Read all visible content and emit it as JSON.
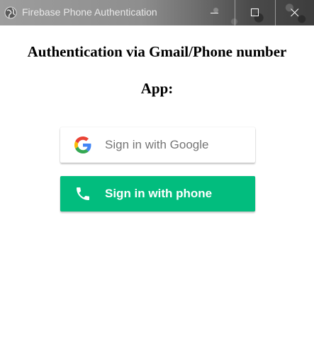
{
  "window": {
    "title": "Firebase Phone Authentication",
    "minimize_icon": "minimize-icon",
    "maximize_icon": "maximize-icon",
    "close_icon": "close-icon",
    "app_icon": "globe-icon"
  },
  "content": {
    "heading_line1": "Authentication via Gmail/Phone number",
    "heading_line2": "App:"
  },
  "buttons": {
    "google": {
      "label": "Sign in with Google",
      "icon": "google-g-icon",
      "background": "#ffffff",
      "text_color": "#757575"
    },
    "phone": {
      "label": "Sign in with phone",
      "icon": "phone-icon",
      "background": "#02bd7e",
      "text_color": "#ffffff"
    }
  }
}
